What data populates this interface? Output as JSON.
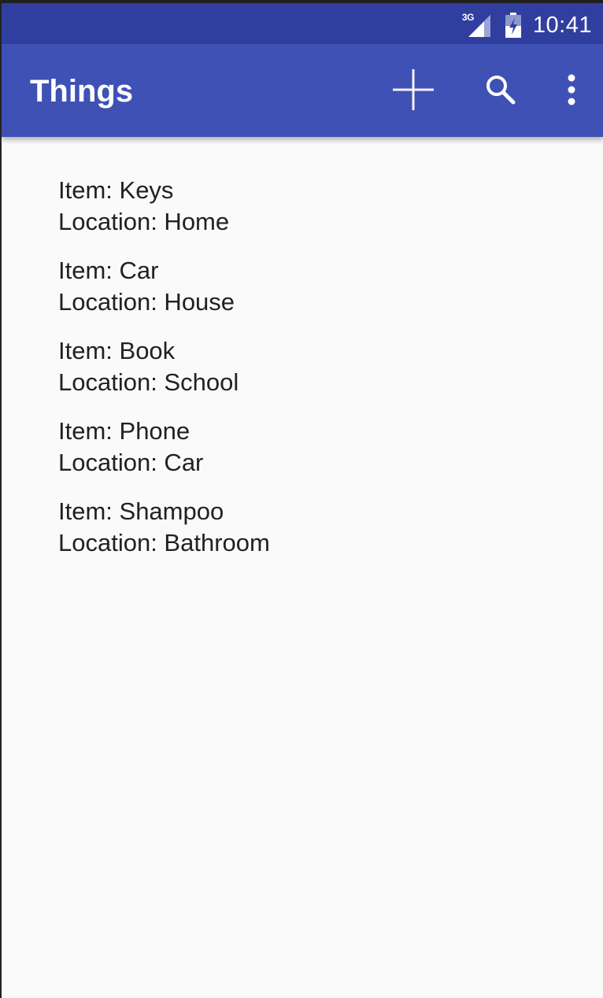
{
  "status_bar": {
    "network_label": "3G",
    "time": "10:41",
    "network_icon": "cell-signal-icon",
    "battery_icon": "battery-charging-icon",
    "background": "#303f9f"
  },
  "app_bar": {
    "title": "Things",
    "background": "#3f51b5",
    "actions": [
      {
        "name": "add",
        "icon": "plus-icon"
      },
      {
        "name": "search",
        "icon": "search-icon"
      },
      {
        "name": "more",
        "icon": "overflow-menu-icon"
      }
    ]
  },
  "items": [
    {
      "item": "Item: Keys",
      "location": "Location: Home"
    },
    {
      "item": "Item: Car",
      "location": "Location: House"
    },
    {
      "item": "Item: Book",
      "location": "Location: School"
    },
    {
      "item": "Item: Phone",
      "location": "Location: Car"
    },
    {
      "item": "Item: Shampoo",
      "location": "Location: Bathroom"
    }
  ]
}
